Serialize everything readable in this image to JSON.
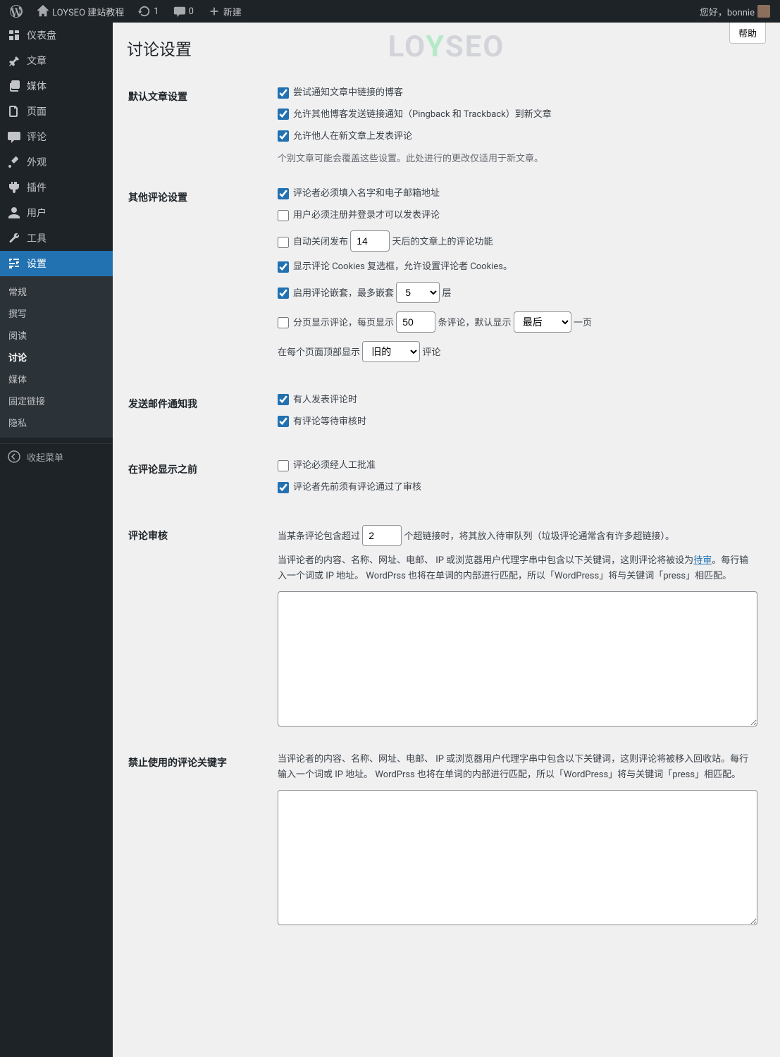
{
  "adminbar": {
    "site_name": "LOYSEO 建站教程",
    "updates_count": "1",
    "comments_count": "0",
    "new_label": "新建",
    "greeting": "您好，bonnie"
  },
  "watermark": {
    "pre": "LO",
    "mid": "Y",
    "post": "SEO"
  },
  "help_label": "帮助",
  "page_title": "讨论设置",
  "sidebar": {
    "items": [
      {
        "label": "仪表盘",
        "icon": "dashboard"
      },
      {
        "label": "文章",
        "icon": "pin"
      },
      {
        "label": "媒体",
        "icon": "media"
      },
      {
        "label": "页面",
        "icon": "page"
      },
      {
        "label": "评论",
        "icon": "comment"
      },
      {
        "label": "外观",
        "icon": "appearance"
      },
      {
        "label": "插件",
        "icon": "plugin"
      },
      {
        "label": "用户",
        "icon": "user"
      },
      {
        "label": "工具",
        "icon": "tool"
      },
      {
        "label": "设置",
        "icon": "settings",
        "active": true
      }
    ],
    "submenu": [
      {
        "label": "常规"
      },
      {
        "label": "撰写"
      },
      {
        "label": "阅读"
      },
      {
        "label": "讨论",
        "active": true
      },
      {
        "label": "媒体"
      },
      {
        "label": "固定链接"
      },
      {
        "label": "隐私"
      }
    ],
    "collapse": "收起菜单"
  },
  "sections": {
    "default_article": {
      "heading": "默认文章设置",
      "opt1": "尝试通知文章中链接的博客",
      "opt2": "允许其他博客发送链接通知（Pingback 和 Trackback）到新文章",
      "opt3": "允许他人在新文章上发表评论",
      "note": "个别文章可能会覆盖这些设置。此处进行的更改仅适用于新文章。"
    },
    "other_comment": {
      "heading": "其他评论设置",
      "opt1": "评论者必须填入名字和电子邮箱地址",
      "opt2": "用户必须注册并登录才可以发表评论",
      "opt3_pre": "自动关闭发布",
      "opt3_days": "14",
      "opt3_post": "天后的文章上的评论功能",
      "opt4": "显示评论 Cookies 复选框，允许设置评论者 Cookies。",
      "opt5_pre": "启用评论嵌套，最多嵌套",
      "opt5_val": "5",
      "opt5_post": "层",
      "opt6_pre": "分页显示评论，每页显示",
      "opt6_val": "50",
      "opt6_mid": "条评论，默认显示",
      "opt6_sel": "最后",
      "opt6_post": "一页",
      "opt7_pre": "在每个页面顶部显示",
      "opt7_sel": "旧的",
      "opt7_post": "评论"
    },
    "email_me": {
      "heading": "发送邮件通知我",
      "opt1": "有人发表评论时",
      "opt2": "有评论等待审核时"
    },
    "before_appear": {
      "heading": "在评论显示之前",
      "opt1": "评论必须经人工批准",
      "opt2": "评论者先前须有评论通过了审核"
    },
    "moderation": {
      "heading": "评论审核",
      "links_pre": "当某条评论包含超过",
      "links_val": "2",
      "links_post": "个超链接时，将其放入待审队列（垃圾评论通常含有许多超链接）。",
      "desc_pre": "当评论者的内容、名称、网址、电邮、 IP 或浏览器用户代理字串中包含以下关键词，这则评论将被设为",
      "desc_link": "待审",
      "desc_post": "。每行输入一个词或 IP 地址。 WordPrss 也将在单词的内部进行匹配，所以「WordPress」将与关键词「press」相匹配。"
    },
    "disallowed": {
      "heading": "禁止使用的评论关键字",
      "desc": "当评论者的内容、名称、网址、电邮、 IP 或浏览器用户代理字串中包含以下关键词，这则评论将被移入回收站。每行输入一个词或 IP 地址。 WordPrss 也将在单词的内部进行匹配，所以「WordPress」将与关键词「press」相匹配。"
    }
  }
}
